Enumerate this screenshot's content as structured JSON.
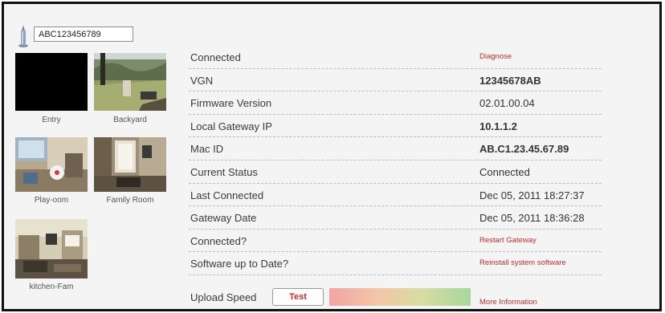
{
  "header": {
    "device_id": "ABC123456789"
  },
  "cameras": [
    {
      "name": "Entry"
    },
    {
      "name": "Backyard"
    },
    {
      "name": "Play-oom"
    },
    {
      "name": "Family Room"
    },
    {
      "name": "kitchen-Fam"
    }
  ],
  "info": {
    "connected": {
      "label": "Connected",
      "action": "Diagnose"
    },
    "vgn": {
      "label": "VGN",
      "value": "12345678AB"
    },
    "firmware": {
      "label": "Firmware Version",
      "value": "02.01.00.04"
    },
    "local_ip": {
      "label": "Local Gateway IP",
      "value": "10.1.1.2"
    },
    "mac_id": {
      "label": "Mac ID",
      "value": "AB.C1.23.45.67.89"
    },
    "status": {
      "label": "Current Status",
      "value": "Connected"
    },
    "last_connected": {
      "label": "Last Connected",
      "value": "Dec 05, 2011 18:27:37"
    },
    "gateway_date": {
      "label": "Gateway Date",
      "value": "Dec 05, 2011 18:36:28"
    },
    "connected_q": {
      "label": "Connected?",
      "action": "Restart Gateway"
    },
    "software": {
      "label": "Software up to Date?",
      "action": "Reinstall system software"
    }
  },
  "upload": {
    "label": "Upload Speed",
    "test_label": "Test",
    "more_label": "More Information"
  },
  "colors": {
    "link": "#b5302a",
    "frame_border": "#111111",
    "panel_bg": "#f4f4f4"
  }
}
